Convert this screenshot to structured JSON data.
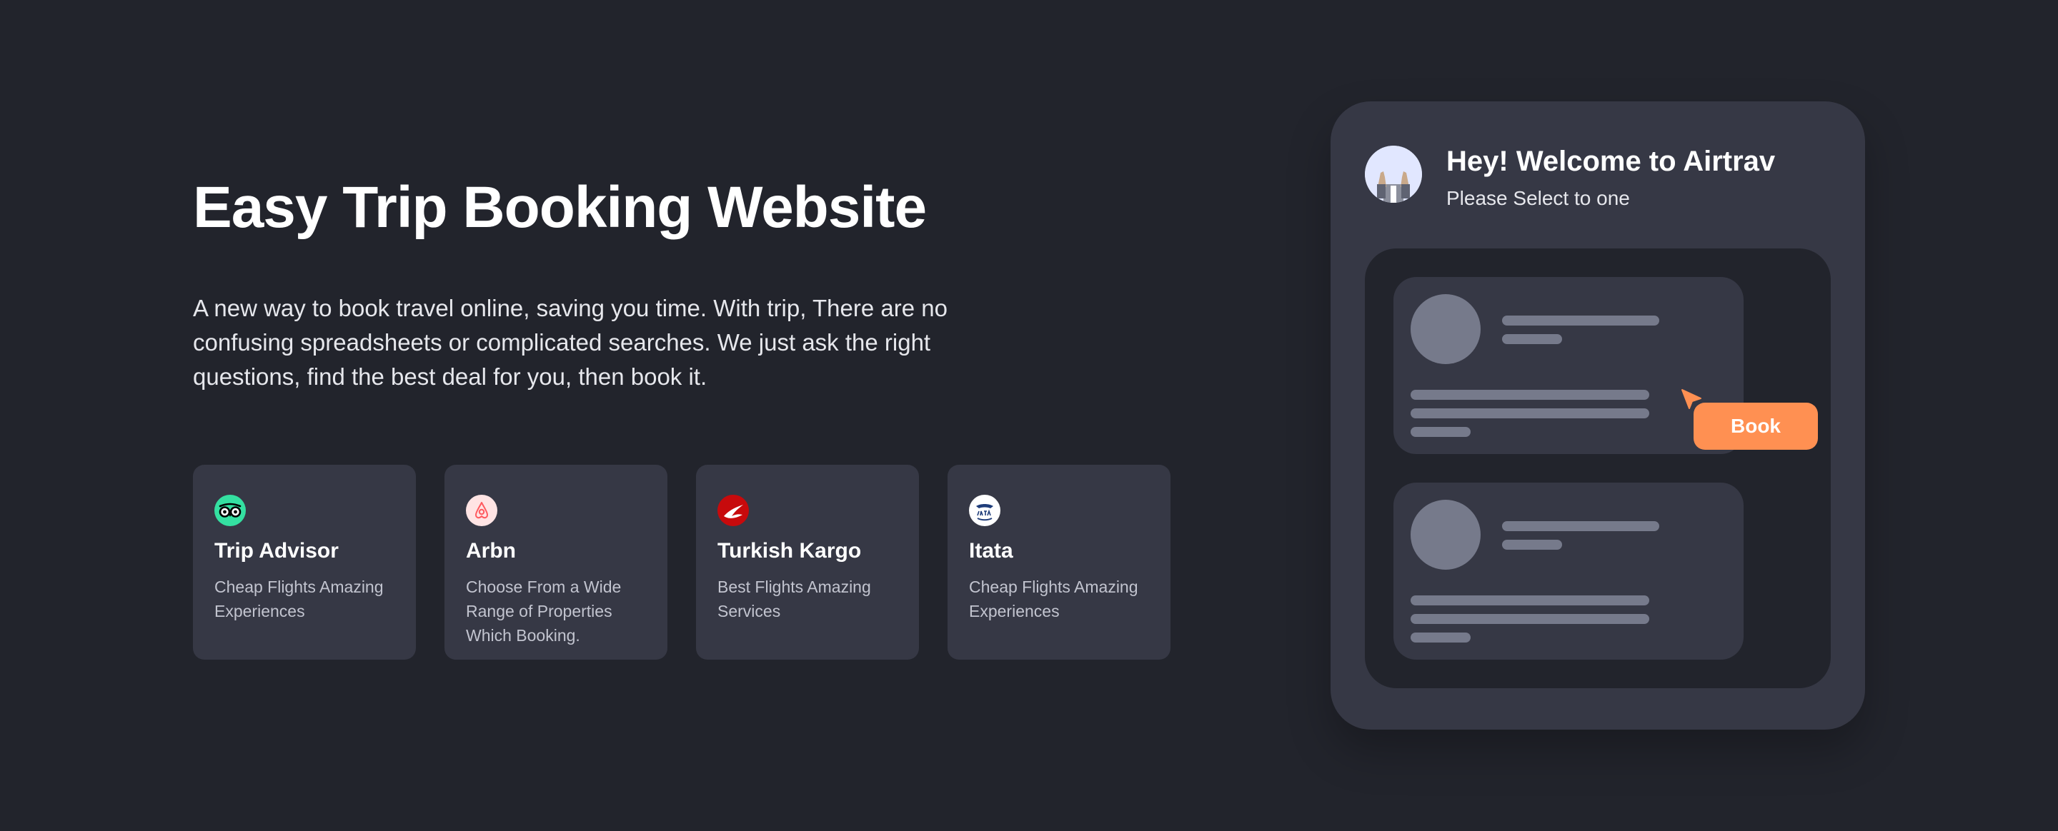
{
  "hero": {
    "title": "Easy Trip Booking Website",
    "description": "A new way to book travel online, saving you time. With trip, There are no confusing spreadsheets or complicated searches. We just ask the right questions, find the best deal for you, then book it."
  },
  "partners": [
    {
      "name": "Trip Advisor",
      "description": "Cheap Flights Amazing Experiences",
      "icon": "tripadvisor-logo-icon",
      "color": "#34e0a1"
    },
    {
      "name": "Arbn",
      "description": "Choose From a Wide Range of Properties Which Booking.",
      "icon": "airbnb-logo-icon",
      "color": "#ff5a5f"
    },
    {
      "name": "Turkish Kargo",
      "description": "Best Flights Amazing Services",
      "icon": "turkish-airlines-logo-icon",
      "color": "#c70a0c"
    },
    {
      "name": "Itata",
      "description": "Cheap Flights Amazing Experiences",
      "icon": "iata-logo-icon",
      "color": "#1f3d7a"
    }
  ],
  "mock": {
    "greeting": "Hey! Welcome to Airtrav",
    "subtitle": "Please Select to one",
    "book_label": "Book",
    "avatar_icon": "raised-hands-avatar-icon",
    "cursor_icon": "cursor-pointer-icon"
  },
  "colors": {
    "background": "#22242c",
    "card": "#363845",
    "accent": "#ff9052",
    "skeleton": "#767a8b"
  }
}
